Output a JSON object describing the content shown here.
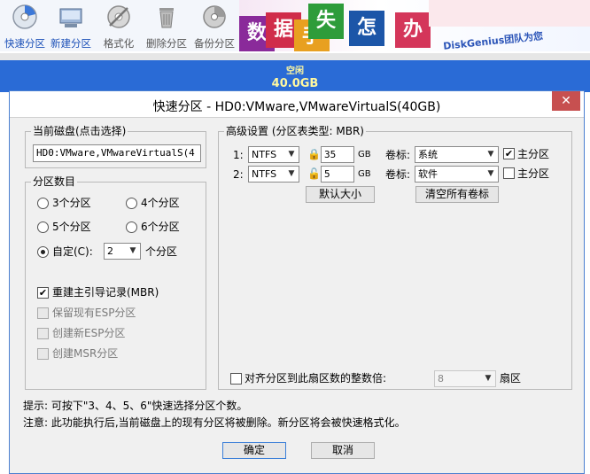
{
  "toolbar": {
    "items": [
      {
        "label": "快速分区",
        "icon": "quick-partition-icon"
      },
      {
        "label": "新建分区",
        "icon": "new-partition-icon"
      },
      {
        "label": "格式化",
        "icon": "format-icon"
      },
      {
        "label": "删除分区",
        "icon": "delete-icon"
      },
      {
        "label": "备份分区",
        "icon": "backup-icon"
      }
    ]
  },
  "banner": {
    "glyphs": [
      "数",
      "据",
      "手",
      "失",
      "怎",
      "办"
    ],
    "brand": "DiskGenius团队为您"
  },
  "disk": {
    "label": "空闲",
    "size": "40.0GB"
  },
  "dialog": {
    "title": "快速分区 - HD0:VMware,VMwareVirtualS(40GB)",
    "close": "✕",
    "current_disk": {
      "caption": "当前磁盘(点击选择)",
      "value": "HD0:VMware,VMwareVirtualS(4"
    },
    "partition_count": {
      "caption": "分区数目",
      "options": [
        "3个分区",
        "4个分区",
        "5个分区",
        "6个分区"
      ],
      "custom_label": "自定(C):",
      "custom_value": "2",
      "custom_suffix": "个分区",
      "selected": "custom"
    },
    "checks": {
      "rebuild_mbr": "重建主引导记录(MBR)",
      "keep_esp": "保留现有ESP分区",
      "create_esp": "创建新ESP分区",
      "create_msr": "创建MSR分区"
    },
    "advanced": {
      "caption": "高级设置 (分区表类型: MBR)",
      "rows": [
        {
          "index": "1:",
          "fs": "NTFS",
          "size": "35",
          "unit": "GB",
          "vol_label": "卷标:",
          "vol": "系统",
          "primary": "主分区",
          "primary_checked": true
        },
        {
          "index": "2:",
          "fs": "NTFS",
          "size": "5",
          "unit": "GB",
          "vol_label": "卷标:",
          "vol": "软件",
          "primary": "主分区",
          "primary_checked": false
        }
      ],
      "default_size_btn": "默认大小",
      "clear_labels_btn": "清空所有卷标",
      "align_label": "对齐分区到此扇区数的整数倍:",
      "align_value": "8",
      "align_unit": "扇区"
    },
    "hint": "提示: 可按下\"3、4、5、6\"快速选择分区个数。",
    "note": "注意: 此功能执行后,当前磁盘上的现有分区将被删除。新分区将会被快速格式化。",
    "ok": "确定",
    "cancel": "取消"
  }
}
